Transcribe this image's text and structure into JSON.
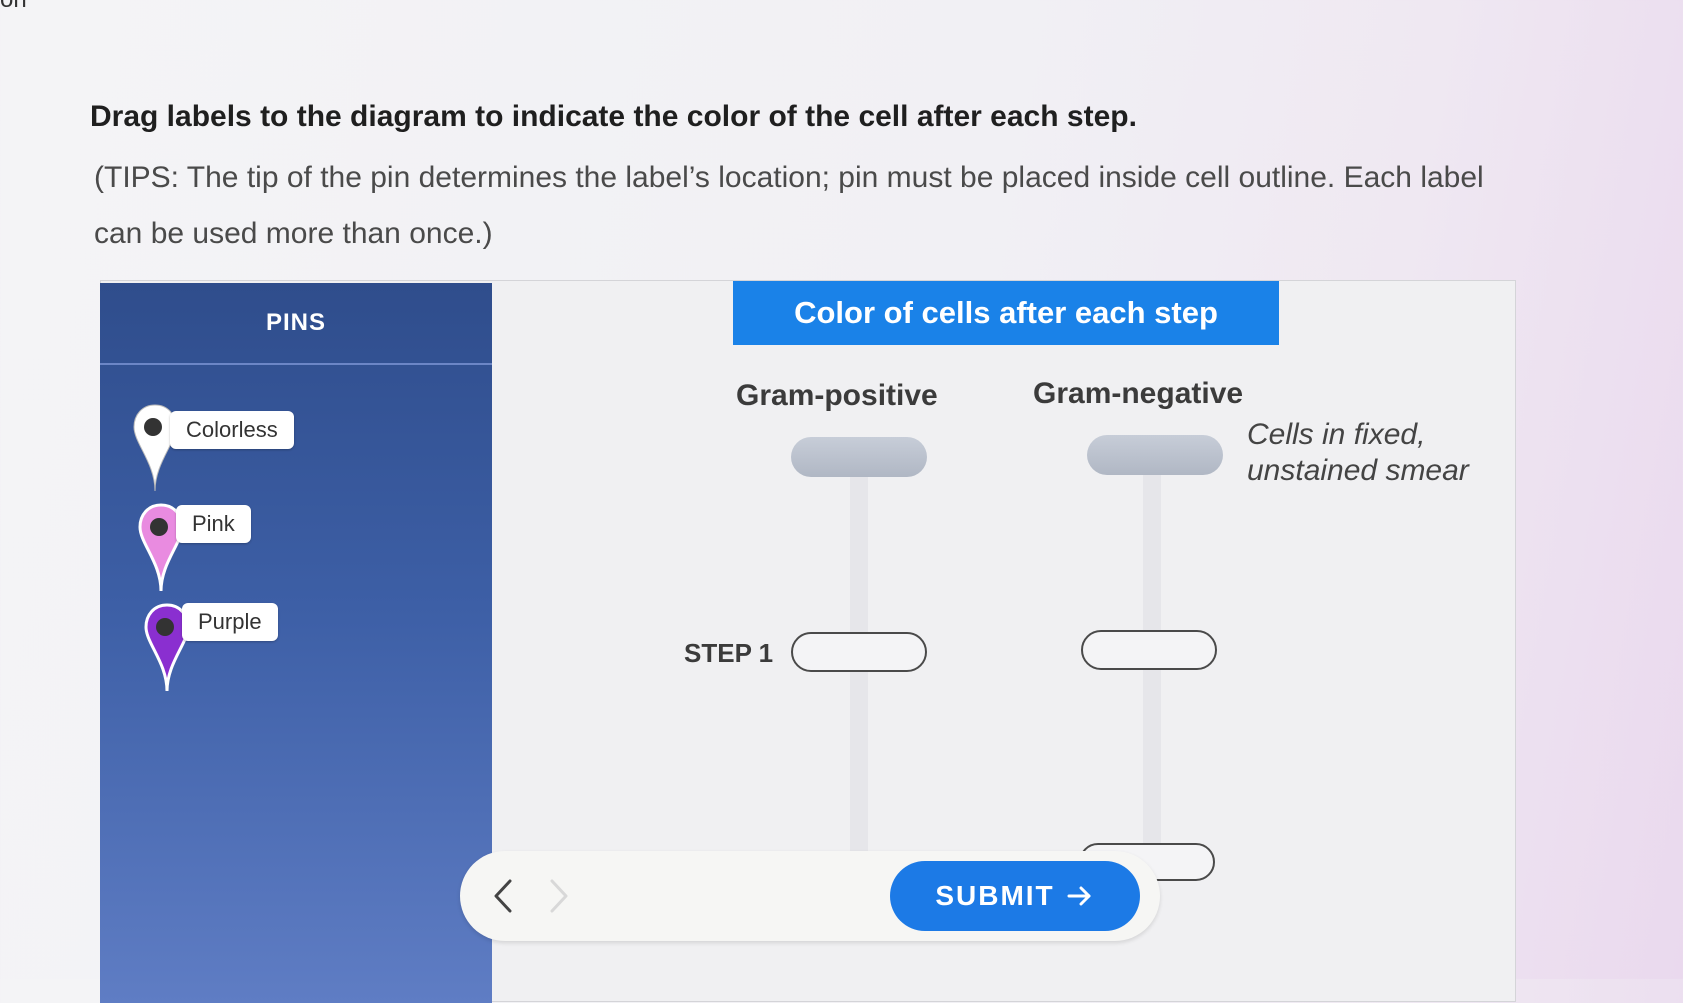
{
  "page": {
    "corner_text": "on",
    "instruction": "Drag labels to the diagram to indicate the color of the cell after each step.",
    "tips": "(TIPS: The tip of the pin determines the label’s location; pin must be placed inside cell outline. Each label can be used more than once.)"
  },
  "pins": {
    "header": "PINS",
    "items": [
      {
        "label": "Colorless",
        "color": "#ffffff"
      },
      {
        "label": "Pink",
        "color": "#e98be0"
      },
      {
        "label": "Purple",
        "color": "#8a2fd0"
      }
    ]
  },
  "diagram": {
    "title": "Color of cells after each step",
    "columns": [
      "Gram-positive",
      "Gram-negative"
    ],
    "row_label": "Cells in fixed, unstained smear",
    "step_label": "STEP 1"
  },
  "nav": {
    "submit_label": "SUBMIT",
    "back_icon": "chevron-left-icon",
    "forward_icon": "chevron-right-icon",
    "submit_icon": "arrow-right-icon"
  },
  "colors": {
    "title_bg": "#1a82e8",
    "pins_panel": "#2f4d8c",
    "submit_bg": "#1c7ae6"
  }
}
